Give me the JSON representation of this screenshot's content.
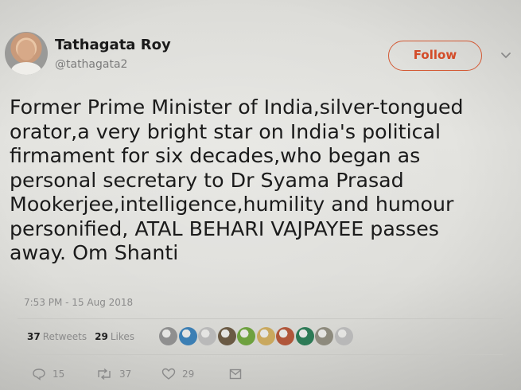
{
  "tweet": {
    "author_name": "Tathagata Roy",
    "author_handle": "@tathagata2",
    "follow_label": "Follow",
    "text": "Former Prime Minister of India,silver-tongued\norator,a very bright star on India's political\nfirmament for six decades,who began as\npersonal secretary to Dr Syama Prasad\nMookerjee,intelligence,humility and humour\npersonified, ATAL BEHARI VAJPAYEE passes\naway. Om Shanti",
    "timestamp": "7:53 PM - 15 Aug 2018"
  },
  "stats": {
    "retweets_count": "37",
    "retweets_label": "Retweets",
    "likes_count": "29",
    "likes_label": "Likes"
  },
  "actions": {
    "reply_count": "15",
    "retweet_count": "37",
    "like_count": "29"
  },
  "icons": {
    "reply": "reply-icon",
    "retweet": "retweet-icon",
    "like": "heart-icon",
    "dm": "message-icon",
    "caret": "chevron-down-icon"
  },
  "colors": {
    "follow_accent": "#d34b28",
    "muted_text": "#8a8a8a"
  },
  "likers": [
    {
      "color": "#8f8f8f"
    },
    {
      "color": "#3c7fb4"
    },
    {
      "color": "#b9b9b9"
    },
    {
      "color": "#6a5a44"
    },
    {
      "color": "#6ea13f"
    },
    {
      "color": "#c9a85e"
    },
    {
      "color": "#b0563a"
    },
    {
      "color": "#2d7a56"
    },
    {
      "color": "#8d8a7d"
    },
    {
      "color": "#b8b8b8"
    }
  ]
}
